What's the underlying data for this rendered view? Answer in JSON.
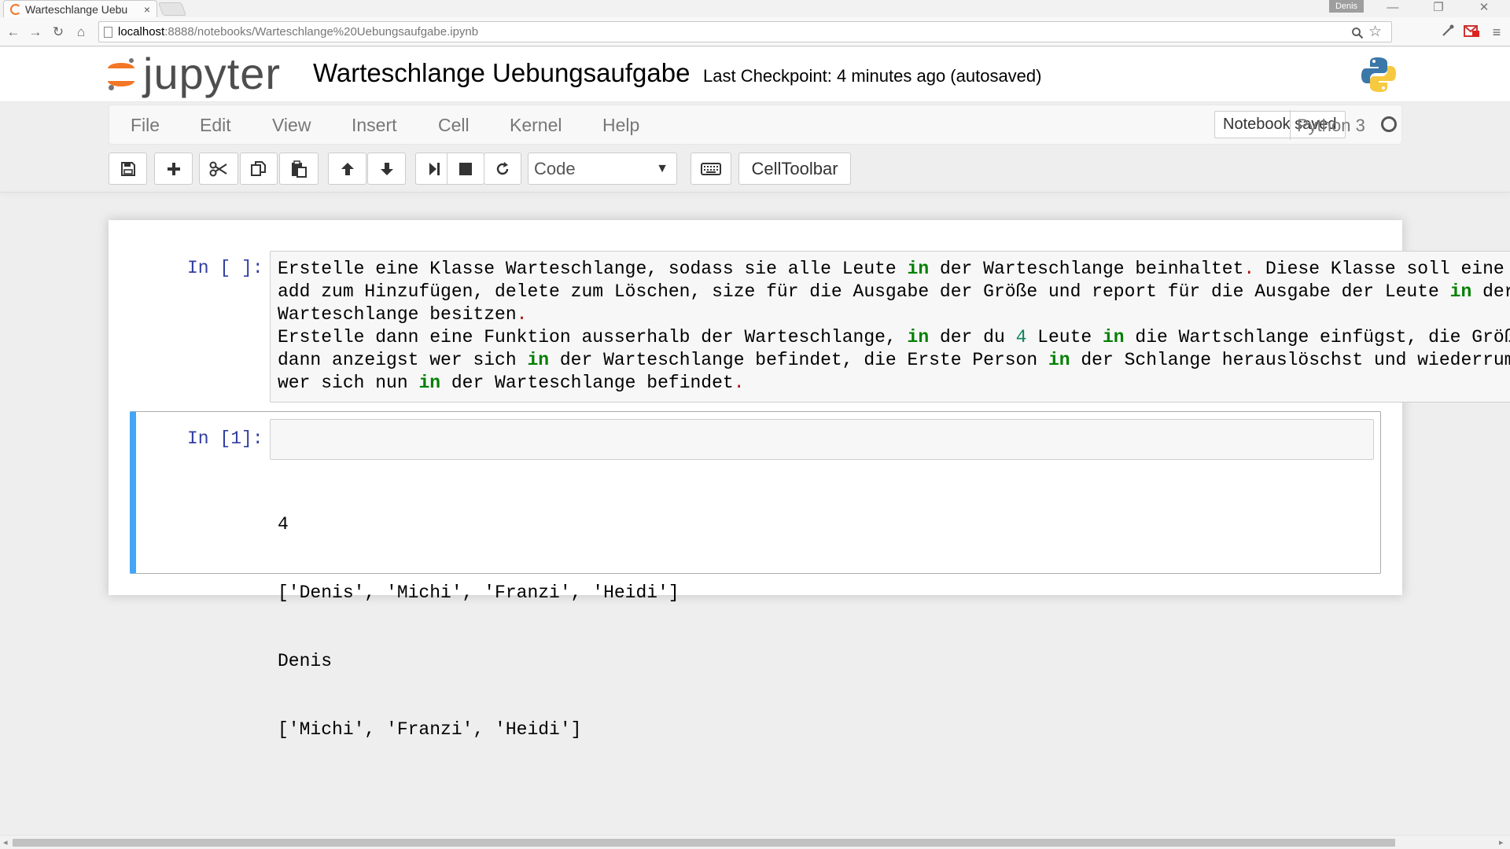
{
  "browser": {
    "tab_title": "Warteschlange Uebu",
    "tab_close": "×",
    "user_badge": "Denis",
    "url_host": "localhost",
    "url_path": ":8888/notebooks/Warteschlange%20Uebungsaufgabe.ipynb",
    "window_controls": {
      "minimize": "—",
      "restore": "❐",
      "close": "✕"
    },
    "nav": {
      "back": "←",
      "forward": "→",
      "reload": "↻",
      "home": "⌂"
    }
  },
  "header": {
    "logo_text": "jupyter",
    "notebook_name": "Warteschlange Uebungsaufgabe",
    "checkpoint": "Last Checkpoint: 4 minutes ago (autosaved)"
  },
  "menubar": {
    "items": [
      "File",
      "Edit",
      "View",
      "Insert",
      "Cell",
      "Kernel",
      "Help"
    ],
    "status": "Notebook saved",
    "kernel": "Python 3"
  },
  "toolbar": {
    "cell_type": "Code",
    "celltoolbar_label": "CellToolbar",
    "buttons": [
      "save-icon",
      "plus-icon",
      "cut-icon",
      "copy-icon",
      "paste-icon",
      "arrow-up-icon",
      "arrow-down-icon",
      "run-icon",
      "stop-icon",
      "restart-icon",
      "keyboard-icon"
    ]
  },
  "cells": [
    {
      "prompt": "In [ ]:",
      "lines": [
        [
          {
            "t": "Erstelle eine Klasse Warteschlange, sodass sie alle Leute "
          },
          {
            "t": "in",
            "c": "kw"
          },
          {
            "t": " der Warteschlange beinhaltet"
          },
          {
            "t": ".",
            "c": "red"
          },
          {
            "t": " Diese Klasse soll eine Fu"
          }
        ],
        [
          {
            "t": "add zum Hinzufügen, delete zum Löschen, size für die Ausgabe der Größe und report für die Ausgabe der Leute "
          },
          {
            "t": "in",
            "c": "kw"
          },
          {
            "t": " der"
          }
        ],
        [
          {
            "t": "Warteschlange besitzen"
          },
          {
            "t": ".",
            "c": "red"
          }
        ],
        [
          {
            "t": "Erstelle dann eine Funktion ausserhalb der Warteschlange, "
          },
          {
            "t": "in",
            "c": "kw"
          },
          {
            "t": " der du "
          },
          {
            "t": "4",
            "c": "num"
          },
          {
            "t": " Leute "
          },
          {
            "t": "in",
            "c": "kw"
          },
          {
            "t": " die Wartschlange einfügst, die Größe a"
          }
        ],
        [
          {
            "t": "dann anzeigst wer sich "
          },
          {
            "t": "in",
            "c": "kw"
          },
          {
            "t": " der Warteschlange befindet, die Erste Person "
          },
          {
            "t": "in",
            "c": "kw"
          },
          {
            "t": " der Schlange herauslöschst und wiederrum an"
          }
        ],
        [
          {
            "t": "wer sich nun "
          },
          {
            "t": "in",
            "c": "kw"
          },
          {
            "t": " der Warteschlange befindet"
          },
          {
            "t": ".",
            "c": "red"
          }
        ]
      ]
    },
    {
      "prompt": "In [1]:",
      "output": [
        "4",
        "['Denis', 'Michi', 'Franzi', 'Heidi']",
        "Denis",
        "['Michi', 'Franzi', 'Heidi']"
      ]
    }
  ],
  "colors": {
    "jupyter_orange": "#f37726",
    "prompt_blue": "#303f9f",
    "selected_cell": "#42a5f5",
    "keyword_green": "#008000"
  }
}
